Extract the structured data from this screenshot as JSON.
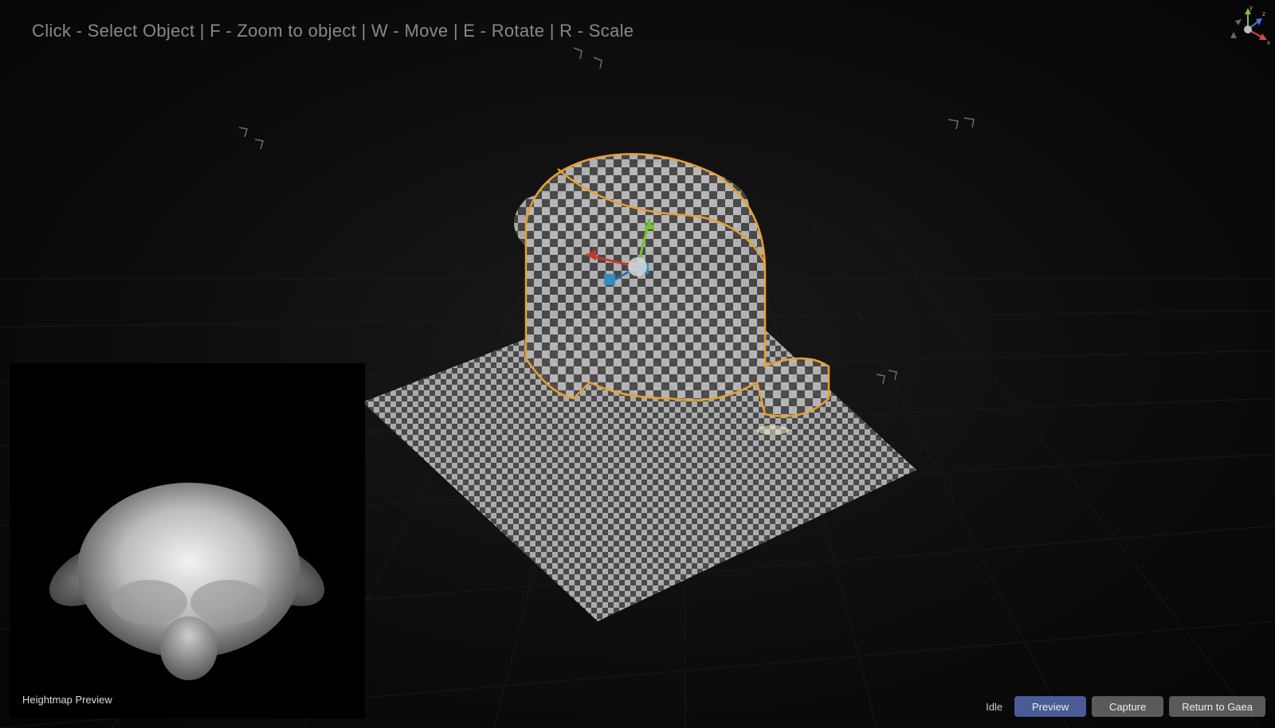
{
  "helpText": "Click - Select Object | F - Zoom to object | W - Move | E - Rotate | R - Scale",
  "axisGizmo": {
    "labels": {
      "x": "x",
      "y": "y",
      "z": "z"
    }
  },
  "heightmap": {
    "label": "Heightmap Preview"
  },
  "bottomBar": {
    "status": "Idle",
    "buttons": {
      "preview": "Preview",
      "capture": "Capture",
      "return": "Return to Gaea"
    }
  },
  "colors": {
    "accent": "#4b5b95",
    "secondaryButton": "#5a5a5a",
    "background": "#0a0a0a",
    "helpText": "#888"
  }
}
